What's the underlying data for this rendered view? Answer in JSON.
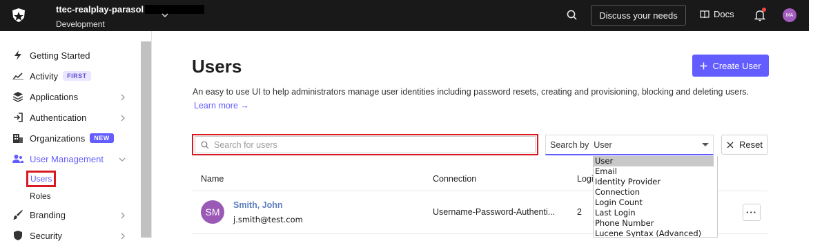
{
  "topbar": {
    "tenant_name": "ttec-realplay-parasol",
    "tenant_env": "Development",
    "discuss_label": "Discuss your needs",
    "docs_label": "Docs",
    "avatar_initials": "MA"
  },
  "sidebar": {
    "items": [
      {
        "label": "Getting Started",
        "icon": "lightning-icon"
      },
      {
        "label": "Activity",
        "icon": "activity-chart-icon",
        "badge": "FIRST"
      },
      {
        "label": "Applications",
        "icon": "layers-icon"
      },
      {
        "label": "Authentication",
        "icon": "arrow-login-icon"
      },
      {
        "label": "Organizations",
        "icon": "building-icon",
        "badge": "NEW"
      },
      {
        "label": "User Management",
        "icon": "users-icon"
      },
      {
        "label": "Branding",
        "icon": "brush-icon"
      },
      {
        "label": "Security",
        "icon": "shield-icon"
      }
    ],
    "sub_items": [
      "Users",
      "Roles"
    ]
  },
  "main": {
    "title": "Users",
    "create_label": "Create User",
    "description": "An easy to use UI to help administrators manage user identities including password resets, creating and provisioning, blocking and deleting users.",
    "learn_more": "Learn more →",
    "search_placeholder": "Search for users",
    "search_by_label": "Search by",
    "search_by_value": "User",
    "reset_label": "Reset",
    "table": {
      "headers": [
        "Name",
        "Connection",
        "Logi"
      ],
      "rows": [
        {
          "initials": "SM",
          "name": "Smith, John",
          "email": "j.smith@test.com",
          "connection": "Username-Password-Authenti...",
          "logins": "2"
        }
      ]
    },
    "dropdown_options": [
      "User",
      "Email",
      "Identity Provider",
      "Connection",
      "Login Count",
      "Last Login",
      "Phone Number",
      "Lucene Syntax (Advanced)"
    ]
  },
  "colors": {
    "accent": "#635dff",
    "topbar": "#191919",
    "highlight_box": "#d71920",
    "avatar": "#9b59b6"
  }
}
